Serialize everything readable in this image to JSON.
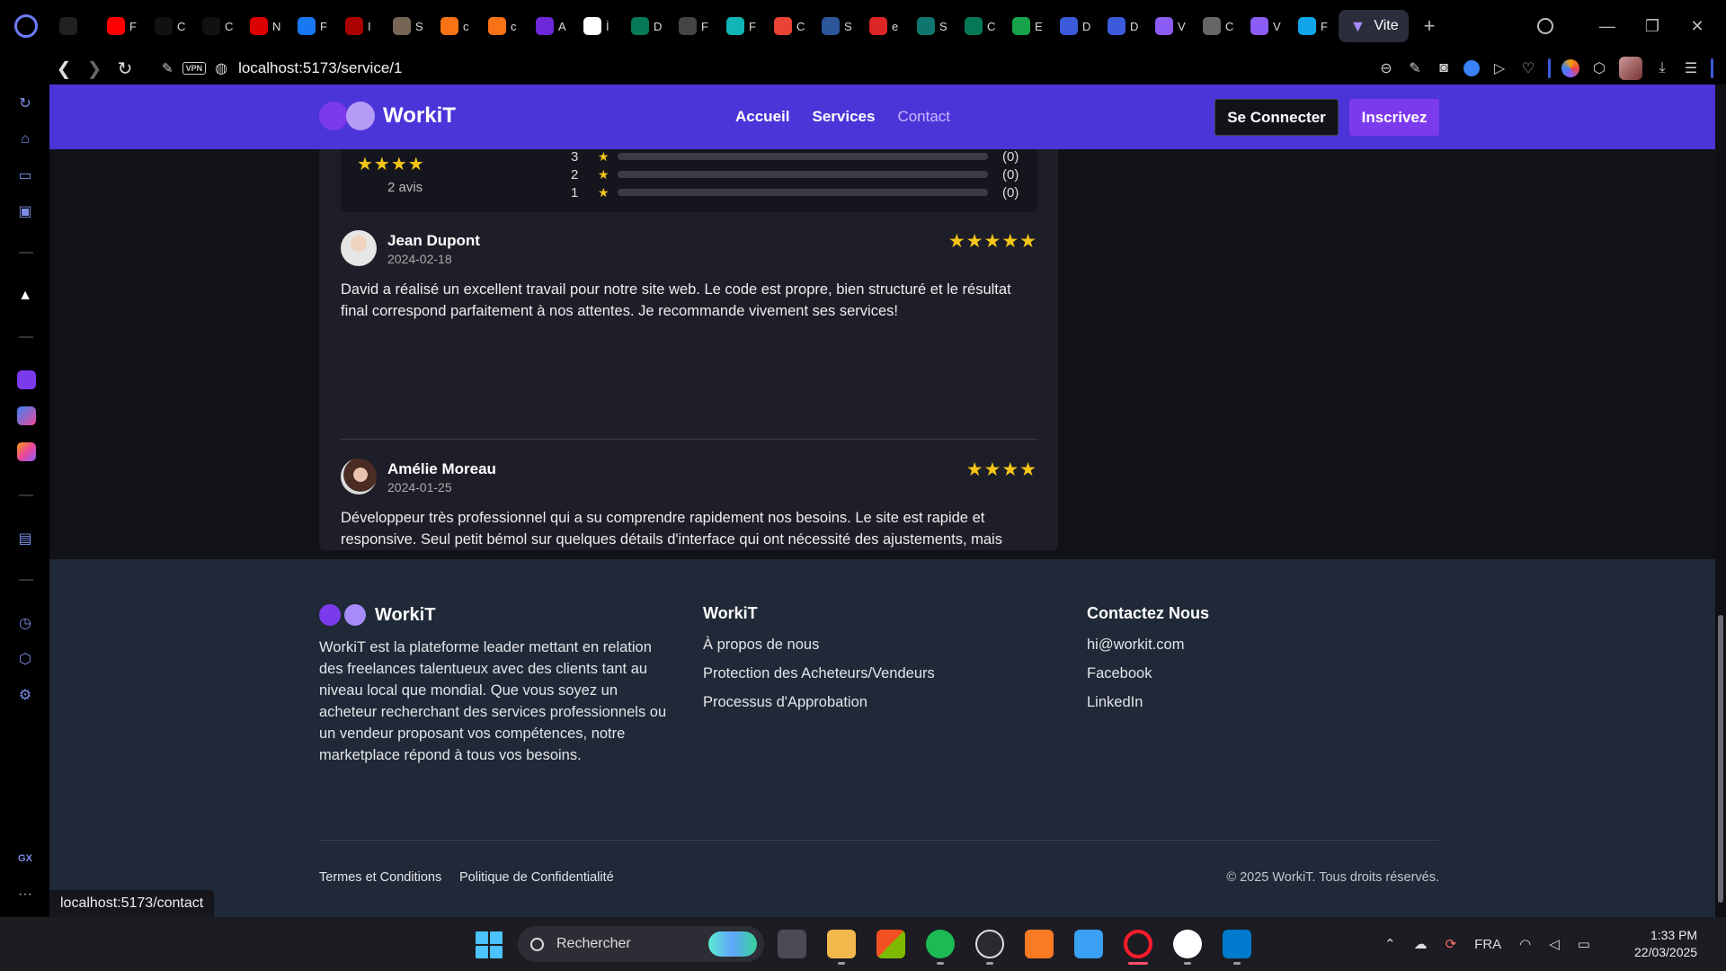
{
  "browser": {
    "tabs": [
      {
        "icon": "gamepad-icon",
        "letter": "",
        "color": "#222"
      },
      {
        "icon": "youtube-icon",
        "letter": "F",
        "color": "#ff0000"
      },
      {
        "icon": "github-icon",
        "letter": "C",
        "color": "#111"
      },
      {
        "icon": "github-icon",
        "letter": "C",
        "color": "#111"
      },
      {
        "icon": "lock-icon",
        "letter": "N",
        "color": "#d00"
      },
      {
        "icon": "facebook-icon",
        "letter": "F",
        "color": "#1877f2"
      },
      {
        "icon": "speed-icon",
        "letter": "I",
        "color": "#a00"
      },
      {
        "icon": "image-icon",
        "letter": "S",
        "color": "#765"
      },
      {
        "icon": "avast-icon",
        "letter": "c",
        "color": "#f97316"
      },
      {
        "icon": "avast-icon",
        "letter": "c",
        "color": "#f97316"
      },
      {
        "icon": "atlas-icon",
        "letter": "A",
        "color": "#6d28d9"
      },
      {
        "icon": "tumblr-icon",
        "letter": "İ",
        "color": "#fff"
      },
      {
        "icon": "mongodb-icon",
        "letter": "D",
        "color": "#047857"
      },
      {
        "icon": "openai-icon",
        "letter": "F",
        "color": "#444"
      },
      {
        "icon": "circle-icon",
        "letter": "F",
        "color": "#10b5b5"
      },
      {
        "icon": "gmail-icon",
        "letter": "C",
        "color": "#ea4335"
      },
      {
        "icon": "word-icon",
        "letter": "S",
        "color": "#2b579a"
      },
      {
        "icon": "pdf-icon",
        "letter": "e",
        "color": "#dc2626"
      },
      {
        "icon": "t-icon",
        "letter": "S",
        "color": "#0f766e"
      },
      {
        "icon": "mongodb-icon",
        "letter": "C",
        "color": "#047857"
      },
      {
        "icon": "arrow-icon",
        "letter": "E",
        "color": "#16a34a"
      },
      {
        "icon": "angular-icon",
        "letter": "D",
        "color": "#3b5bdb"
      },
      {
        "icon": "angular-icon",
        "letter": "D",
        "color": "#3b5bdb"
      },
      {
        "icon": "vite-icon",
        "letter": "V",
        "color": "#8b5cf6"
      },
      {
        "icon": "docs-icon",
        "letter": "C",
        "color": "#666"
      },
      {
        "icon": "vite-icon",
        "letter": "V",
        "color": "#8b5cf6"
      },
      {
        "icon": "react-icon",
        "letter": "F",
        "color": "#0ea5e9"
      }
    ],
    "active_tab": {
      "icon": "vite-icon",
      "title": "Vite"
    },
    "new_tab": "+",
    "url": "localhost:5173/service/1",
    "vpn": "VPN",
    "status_url": "localhost:5173/contact"
  },
  "header": {
    "brand": "WorkiT",
    "nav": [
      "Accueil",
      "Services",
      "Contact"
    ],
    "login": "Se Connecter",
    "signup": "Inscrivez"
  },
  "rating_summary": {
    "stars": "★★★★",
    "count_label": "2 avis",
    "distribution": [
      {
        "label": "3",
        "count": "(0)",
        "value": 0
      },
      {
        "label": "2",
        "count": "(0)",
        "value": 0
      },
      {
        "label": "1",
        "count": "(0)",
        "value": 0
      }
    ]
  },
  "reviews": [
    {
      "name": "Jean Dupont",
      "date": "2024-02-18",
      "stars": "★★★★★",
      "rating": 5,
      "text": "David a réalisé un excellent travail pour notre site web. Le code est propre, bien structuré et le résultat final correspond parfaitement à nos attentes. Je recommande vivement ses services!"
    },
    {
      "name": "Amélie Moreau",
      "date": "2024-01-25",
      "stars": "★★★★",
      "rating": 4,
      "text": "Développeur très professionnel qui a su comprendre rapidement nos besoins. Le site est rapide et responsive. Seul petit bémol sur quelques détails d'interface qui ont nécessité des ajustements, mais dans l'ensemble, très satisfaite!"
    }
  ],
  "footer": {
    "brand": "WorkiT",
    "description": "WorkiT est la plateforme leader mettant en relation des freelances talentueux avec des clients tant au niveau local que mondial. Que vous soyez un acheteur recherchant des services professionnels ou un vendeur proposant vos compétences, notre marketplace répond à tous vos besoins.",
    "col2_title": "WorkiT",
    "col2_links": [
      "À propos de nous",
      "Protection des Acheteurs/Vendeurs",
      "Processus d'Approbation"
    ],
    "col3_title": "Contactez Nous",
    "col3_links": [
      "hi@workit.com",
      "Facebook",
      "LinkedIn"
    ],
    "bottom_links": [
      "Termes et Conditions",
      "Politique de Confidentialité"
    ],
    "copyright": "© 2025 WorkiT. Tous droits réservés."
  },
  "taskbar": {
    "search_placeholder": "Rechercher",
    "language": "FRA",
    "time": "1:33 PM",
    "date": "22/03/2025"
  },
  "colors": {
    "header_bg": "#4b35d8",
    "accent": "#7c3aed",
    "star": "#f5c518",
    "footer_bg": "#1f2937"
  }
}
